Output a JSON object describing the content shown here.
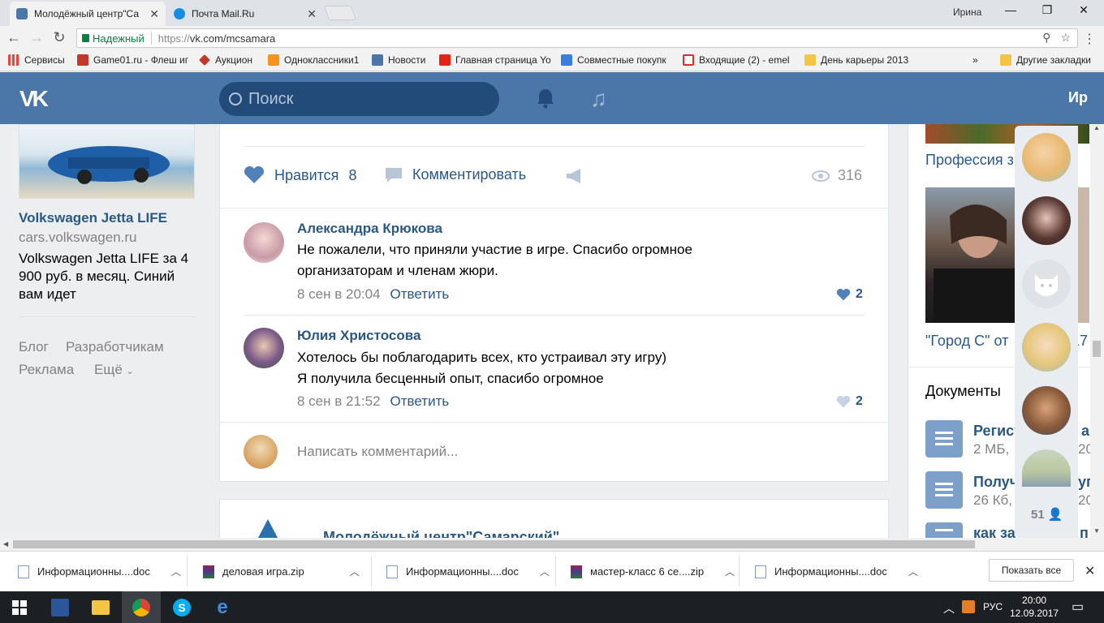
{
  "browser": {
    "tabs": [
      {
        "title": "Молодёжный центр\"Са",
        "favicon_color": "#4a76a8",
        "active": true
      },
      {
        "title": "Почта Mail.Ru",
        "favicon_color": "#168de2",
        "active": false
      }
    ],
    "user": "Ирина",
    "window_controls": [
      "—",
      "❐",
      "✕"
    ],
    "secure_label": "Надежный",
    "url_scheme": "https://",
    "url_rest": "vk.com/mcsamara",
    "bookmarks": [
      {
        "label": "Сервисы",
        "icon_color": "#e8453c"
      },
      {
        "label": "Game01.ru - Флеш иг",
        "icon_color": "#c0392b"
      },
      {
        "label": "Аукцион",
        "icon_color": "#c0392b"
      },
      {
        "label": "Одноклассники1",
        "icon_color": "#f7931e"
      },
      {
        "label": "Новости",
        "icon_color": "#4a76a8"
      },
      {
        "label": "Главная страница Yo",
        "icon_color": "#e62117"
      },
      {
        "label": "Совместные покупк",
        "icon_color": "#3b7ddd"
      },
      {
        "label": "Входящие (2) - emel",
        "icon_color": "#d93025"
      },
      {
        "label": "День карьеры 2013",
        "icon_color": "#f4c542"
      },
      {
        "label": "»",
        "icon_color": ""
      },
      {
        "label": "Другие закладки",
        "icon_color": "#f4c542"
      }
    ]
  },
  "vk": {
    "logo": "VK",
    "search_placeholder": "Поиск",
    "user_name": "Ир"
  },
  "ad": {
    "title": "Volkswagen Jetta LIFE",
    "url": "cars.volkswagen.ru",
    "text": "Volkswagen Jetta LIFE за 4 900 руб. в месяц. Синий вам идет"
  },
  "footer_links": {
    "blog": "Блог",
    "developers": "Разработчикам",
    "ads": "Реклама",
    "more": "Ещё"
  },
  "post": {
    "like_label": "Нравится",
    "like_count": "8",
    "comment_label": "Комментировать",
    "views": "316",
    "comments": [
      {
        "author": "Александра Крюкова",
        "text_line1": "Не пожалели, что приняли участие в игре. Спасибо огромное",
        "text_line2": "организаторам и членам жюри.",
        "time": "8 сен в 20:04",
        "reply": "Ответить",
        "likes": "2",
        "avatar_color": "#d9a6a9"
      },
      {
        "author": "Юлия Христосова",
        "text_line1": "Хотелось бы поблагодарить всех, кто устраивал эту игру)",
        "text_line2": "Я получила бесценный опыт, спасибо огромное",
        "time": "8 сен в 21:52",
        "reply": "Ответить",
        "likes": "2",
        "avatar_color": "#7c5a8a"
      }
    ],
    "composer_placeholder": "Написать комментарий..."
  },
  "next_post": {
    "author": "Молодёжный центр\"Самарский\""
  },
  "right": {
    "link1": "Профессия з",
    "link2": "\"Город С\" от",
    "link2_tail": "17",
    "docs_title": "Документы",
    "docs": [
      {
        "title": "Регист",
        "title_tail": "а",
        "meta": "2 МБ,",
        "meta_tail": "20"
      },
      {
        "title": "Получ",
        "title_tail": "уг",
        "meta": "26 Кб,",
        "meta_tail": "20"
      },
      {
        "title": "как за",
        "title_tail": "п",
        "meta": "",
        "meta_tail": ""
      }
    ]
  },
  "friends": {
    "avatars": [
      "#e9b870",
      "#5a3a34",
      "#dfe3e8",
      "#e6c77a",
      "#8a5a3a",
      "#b9c7a0"
    ],
    "count": "51"
  },
  "downloads": [
    {
      "name": "Информационны....doc",
      "type": "doc"
    },
    {
      "name": "деловая игра.zip",
      "type": "zip"
    },
    {
      "name": "Информационны....doc",
      "type": "doc"
    },
    {
      "name": "мастер-класс 6 се....zip",
      "type": "zip"
    },
    {
      "name": "Информационны....doc",
      "type": "doc"
    }
  ],
  "download_show_all": "Показать все",
  "taskbar": {
    "language": "РУС",
    "time": "20:00",
    "date": "12.09.2017"
  }
}
